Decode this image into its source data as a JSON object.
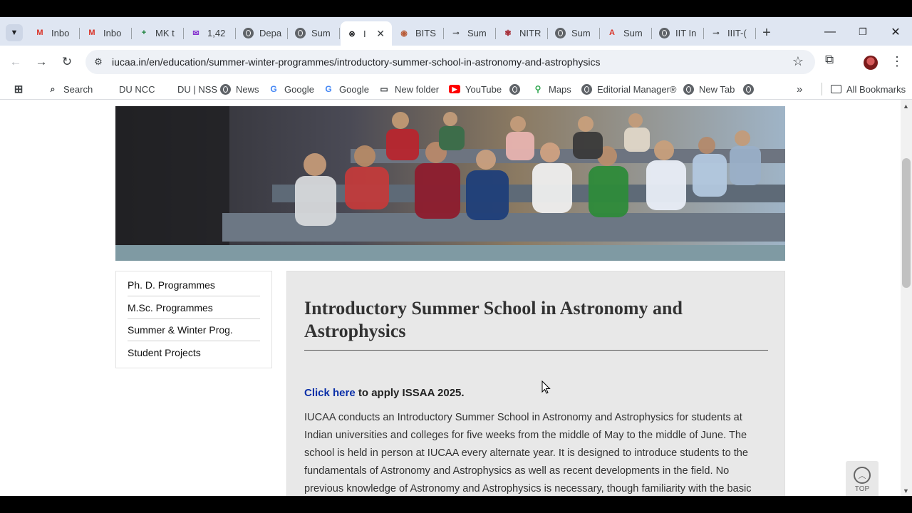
{
  "browser": {
    "tabs": [
      {
        "label": "Inbo",
        "icon": "gmail-icon",
        "glyph": "M",
        "color": "#d93025"
      },
      {
        "label": "Inbo",
        "icon": "gmail-icon",
        "glyph": "M",
        "color": "#d93025"
      },
      {
        "label": "MK t",
        "icon": "sheets-icon",
        "glyph": "+",
        "color": "#188038"
      },
      {
        "label": "1,42",
        "icon": "mail-icon",
        "glyph": "✉",
        "color": "#8430ce"
      },
      {
        "label": "Depa",
        "icon": "globe-icon",
        "glyph": "",
        "color": "#5f6368"
      },
      {
        "label": "Sum",
        "icon": "globe-icon",
        "glyph": "",
        "color": "#5f6368"
      },
      {
        "label": "I",
        "icon": "iucaa-icon",
        "glyph": "⊗",
        "color": "#202124",
        "active": true
      },
      {
        "label": "BITS",
        "icon": "bits-icon",
        "glyph": "◉",
        "color": "#b85c38"
      },
      {
        "label": "Sum",
        "icon": "link-icon",
        "glyph": "⊸",
        "color": "#5f6368"
      },
      {
        "label": "NITR",
        "icon": "nitr-icon",
        "glyph": "✾",
        "color": "#a8323c"
      },
      {
        "label": "Sum",
        "icon": "globe-icon",
        "glyph": "",
        "color": "#5f6368"
      },
      {
        "label": "Sum",
        "icon": "pdf-icon",
        "glyph": "A",
        "color": "#d93025"
      },
      {
        "label": "IIT In",
        "icon": "globe-icon",
        "glyph": "",
        "color": "#5f6368"
      },
      {
        "label": "IIIT-(",
        "icon": "link-icon",
        "glyph": "⊸",
        "color": "#5f6368"
      }
    ],
    "url": "iucaa.in/en/education/summer-winter-programmes/introductory-summer-school-in-astronomy-and-astrophysics",
    "bookmarks": [
      {
        "label": "Search",
        "icon": "search-icon"
      },
      {
        "label": "DU NCC",
        "icon": "blank-icon"
      },
      {
        "label": "DU | NSS",
        "icon": "blank-icon"
      },
      {
        "label": "News",
        "icon": "globe-icon"
      },
      {
        "label": "Google",
        "icon": "google-icon"
      },
      {
        "label": "Google",
        "icon": "google-icon"
      },
      {
        "label": "New folder",
        "icon": "folder-icon"
      },
      {
        "label": "YouTube",
        "icon": "youtube-icon"
      },
      {
        "label": "",
        "icon": "globe-icon"
      },
      {
        "label": "Maps",
        "icon": "maps-icon"
      },
      {
        "label": "Editorial Manager®",
        "icon": "globe-icon"
      },
      {
        "label": "New Tab",
        "icon": "globe-icon"
      },
      {
        "label": "",
        "icon": "globe-icon"
      }
    ],
    "all_bookmarks": "All Bookmarks"
  },
  "sidebar": {
    "items": [
      {
        "label": "Ph. D. Programmes"
      },
      {
        "label": "M.Sc. Programmes"
      },
      {
        "label": "Summer & Winter Prog."
      },
      {
        "label": "Student Projects"
      }
    ]
  },
  "main": {
    "title": "Introductory Summer School in Astronomy and Astrophysics",
    "apply_link": "Click here",
    "apply_rest": " to apply ISSAA 2025.",
    "intro": "IUCAA conducts an Introductory Summer School in Astronomy and Astrophysics for students at Indian universities and colleges for five weeks from the middle of May to the middle of June. The school is held in person at IUCAA every alternate year. It is designed to introduce students to the fundamentals of Astronomy and Astrophysics as well as recent developments in the field. No previous knowledge of Astronomy and Astrophysics is necessary, though familiarity with the basic"
  },
  "top_button": {
    "label": "TOP"
  },
  "colors": {
    "link": "#0a2fa8",
    "tabstrip": "#dfe6f2"
  }
}
